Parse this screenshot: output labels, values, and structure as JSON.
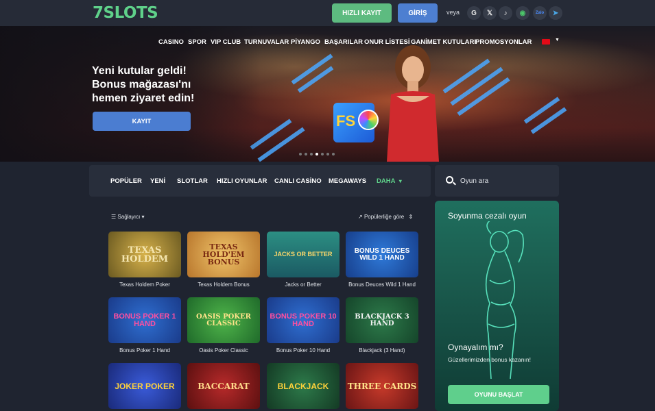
{
  "header": {
    "logo": "7SLOTS",
    "register_button": "HIZLI KAYIT",
    "login_button": "GİRİŞ",
    "or_text": "veya",
    "social": [
      "google-icon",
      "x-icon",
      "tiktok-icon",
      "line-icon",
      "zalo-icon",
      "telegram-icon"
    ],
    "social_glyphs": [
      "G",
      "𝕏",
      "♪",
      "◉",
      "Zalo",
      "➤"
    ]
  },
  "nav": {
    "items": [
      "CASINO",
      "SPOR",
      "VIP CLUB",
      "TURNUVALAR",
      "PİYANGO",
      "BAŞARILAR",
      "ONUR LİSTESİ",
      "GANİMET KUTULARI",
      "PROMOSYONLAR"
    ]
  },
  "hero": {
    "title_line1": "Yeni kutular geldi!",
    "title_line2": "Bonus mağazası'nı",
    "title_line3": "hemen ziyaret edin!",
    "button": "KAYIT",
    "gift_text": "FS",
    "slide_count": 7,
    "active_slide": 3
  },
  "categories": {
    "items": [
      "POPÜLER",
      "YENİ",
      "SLOTLAR",
      "HIZLI OYUNLAR",
      "CANLI CASİNO",
      "MEGAWAYS"
    ],
    "more": "DAHA",
    "more_arrow": "▾",
    "favorites_glyph": "★"
  },
  "search": {
    "placeholder": "Oyun ara"
  },
  "filters": {
    "provider": "Sağlayıcı",
    "provider_icon": "☰",
    "provider_arrow": "▾",
    "sort": "Popülerliğe göre",
    "sort_icon": "↗",
    "sort_arrow": "⇕"
  },
  "games": [
    {
      "name": "Texas Holdem Poker",
      "art": "TEXAS HOLDEM"
    },
    {
      "name": "Texas Holdem Bonus",
      "art": "TEXAS HOLD'EM BONUS"
    },
    {
      "name": "Jacks or Better",
      "art": "JACKS OR BETTER"
    },
    {
      "name": "Bonus Deuces Wild 1 Hand",
      "art": "BONUS DEUCES WILD 1 HAND"
    },
    {
      "name": "Bonus Poker 1 Hand",
      "art": "BONUS POKER 1 HAND"
    },
    {
      "name": "Oasis Poker Classic",
      "art": "OASIS POKER CLASSIC"
    },
    {
      "name": "Bonus Poker 10 Hand",
      "art": "BONUS POKER 10 HAND"
    },
    {
      "name": "Blackjack (3 Hand)",
      "art": "BLACKJACK 3 HAND"
    },
    {
      "name": "",
      "art": "JOKER POKER"
    },
    {
      "name": "",
      "art": "BACCARAT"
    },
    {
      "name": "",
      "art": "BLACKJACK"
    },
    {
      "name": "",
      "art": "THREE CARDS"
    }
  ],
  "promo": {
    "title": "Soyunma cezalı oyun",
    "subtitle": "Oynayalım mı?",
    "text": "Güzellerimizden bonus kazanın!",
    "button": "OYUNU BAŞLAT"
  },
  "colors": {
    "accent_green": "#5fd18a",
    "accent_blue": "#4d7fd1",
    "background": "#1f2430",
    "panel": "#282e3b"
  }
}
